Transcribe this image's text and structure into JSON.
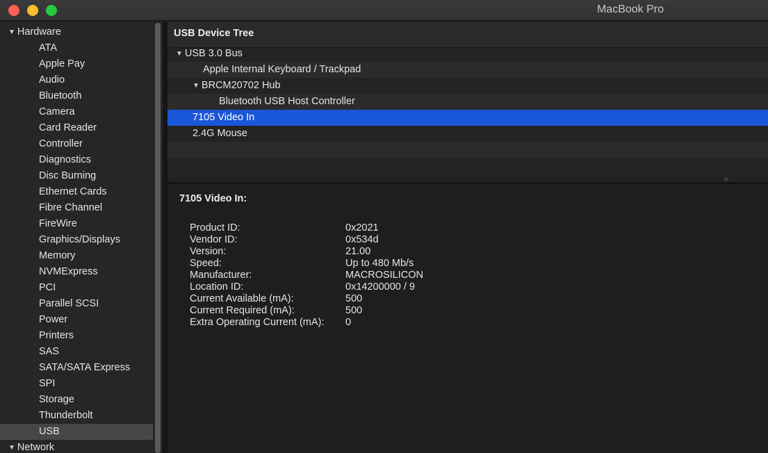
{
  "window": {
    "title": "MacBook Pro"
  },
  "sidebar": {
    "groups": [
      {
        "label": "Hardware",
        "items": [
          "ATA",
          "Apple Pay",
          "Audio",
          "Bluetooth",
          "Camera",
          "Card Reader",
          "Controller",
          "Diagnostics",
          "Disc Burning",
          "Ethernet Cards",
          "Fibre Channel",
          "FireWire",
          "Graphics/Displays",
          "Memory",
          "NVMExpress",
          "PCI",
          "Parallel SCSI",
          "Power",
          "Printers",
          "SAS",
          "SATA/SATA Express",
          "SPI",
          "Storage",
          "Thunderbolt",
          "USB"
        ],
        "selected_item": "USB"
      },
      {
        "label": "Network",
        "items": []
      }
    ]
  },
  "tree": {
    "header": "USB Device Tree",
    "rows": [
      {
        "label": "USB 3.0 Bus",
        "expanded": true
      },
      {
        "label": "Apple Internal Keyboard / Trackpad"
      },
      {
        "label": "BRCM20702 Hub",
        "expanded": true
      },
      {
        "label": "Bluetooth USB Host Controller"
      },
      {
        "label": "7105 Video In",
        "selected": true
      },
      {
        "label": "2.4G Mouse"
      }
    ]
  },
  "detail": {
    "title": "7105 Video In:",
    "properties": [
      {
        "label": "Product ID:",
        "value": "0x2021"
      },
      {
        "label": "Vendor ID:",
        "value": "0x534d"
      },
      {
        "label": "Version:",
        "value": "21.00"
      },
      {
        "label": "Speed:",
        "value": "Up to 480 Mb/s"
      },
      {
        "label": "Manufacturer:",
        "value": "MACROSILICON"
      },
      {
        "label": "Location ID:",
        "value": "0x14200000 / 9"
      },
      {
        "label": "Current Available (mA):",
        "value": "500"
      },
      {
        "label": "Current Required (mA):",
        "value": "500"
      },
      {
        "label": "Extra Operating Current (mA):",
        "value": "0"
      }
    ]
  },
  "colors": {
    "selection": "#1a56d9",
    "close": "#fe5f57",
    "minimize": "#febc2e",
    "zoom": "#28c840"
  }
}
